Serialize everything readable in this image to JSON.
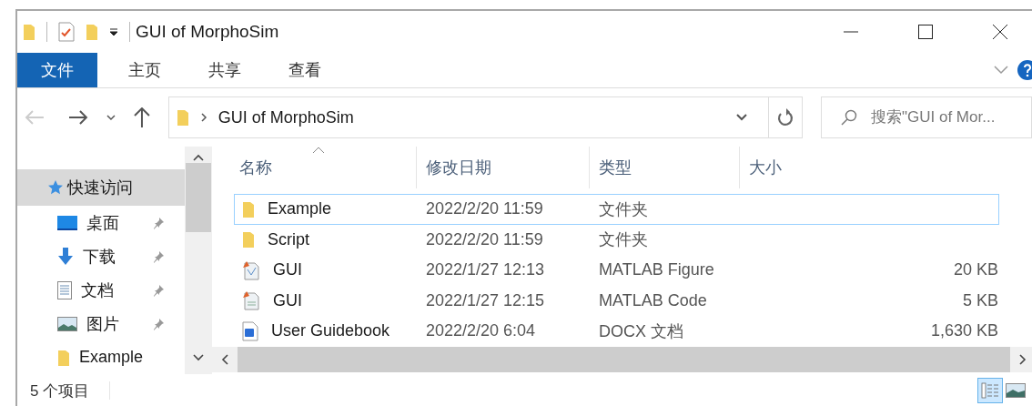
{
  "window": {
    "title": "GUI of MorphoSim"
  },
  "ribbon_tabs": [
    {
      "label": "文件",
      "selected": true
    },
    {
      "label": "主页",
      "selected": false
    },
    {
      "label": "共享",
      "selected": false
    },
    {
      "label": "查看",
      "selected": false
    }
  ],
  "address": {
    "path": "GUI of MorphoSim"
  },
  "search": {
    "placeholder": "搜索\"GUI of Mor..."
  },
  "nav_items": [
    {
      "label": "快速访问",
      "kind": "star",
      "pinned": false,
      "selected": true
    },
    {
      "label": "桌面",
      "kind": "desktop",
      "pinned": true,
      "selected": false
    },
    {
      "label": "下载",
      "kind": "download",
      "pinned": true,
      "selected": false
    },
    {
      "label": "文档",
      "kind": "document",
      "pinned": true,
      "selected": false
    },
    {
      "label": "图片",
      "kind": "pictures",
      "pinned": true,
      "selected": false
    },
    {
      "label": "Example",
      "kind": "folder",
      "pinned": false,
      "selected": false
    }
  ],
  "columns": [
    {
      "label": "名称",
      "sorted": true
    },
    {
      "label": "修改日期",
      "sorted": false
    },
    {
      "label": "类型",
      "sorted": false
    },
    {
      "label": "大小",
      "sorted": false
    }
  ],
  "rows": [
    {
      "name": "Example",
      "kind": "folder",
      "date": "2022/2/20 11:59",
      "type": "文件夹",
      "size": "",
      "focused": true
    },
    {
      "name": "Script",
      "kind": "folder",
      "date": "2022/2/20 11:59",
      "type": "文件夹",
      "size": "",
      "focused": false
    },
    {
      "name": "GUI",
      "kind": "figure",
      "date": "2022/1/27 12:13",
      "type": "MATLAB Figure",
      "size": "20 KB",
      "focused": false
    },
    {
      "name": "GUI",
      "kind": "code",
      "date": "2022/1/27 12:15",
      "type": "MATLAB Code",
      "size": "5 KB",
      "focused": false
    },
    {
      "name": "User Guidebook",
      "kind": "docx",
      "date": "2022/2/20 6:04",
      "type": "DOCX 文档",
      "size": "1,630 KB",
      "focused": false
    }
  ],
  "status_bar": {
    "count": "5 个项目"
  },
  "view_buttons": [
    {
      "kind": "details",
      "selected": true
    },
    {
      "kind": "thumbnails",
      "selected": false
    }
  ]
}
